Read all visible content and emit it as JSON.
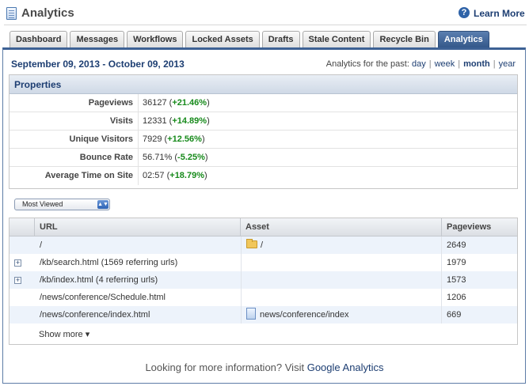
{
  "header": {
    "title": "Analytics",
    "learn_more": "Learn More"
  },
  "tabs": [
    {
      "label": "Dashboard"
    },
    {
      "label": "Messages"
    },
    {
      "label": "Workflows"
    },
    {
      "label": "Locked Assets"
    },
    {
      "label": "Drafts"
    },
    {
      "label": "Stale Content"
    },
    {
      "label": "Recycle Bin"
    },
    {
      "label": "Analytics",
      "active": true
    }
  ],
  "date_range": "September 09, 2013 - October 09, 2013",
  "period": {
    "prefix": "Analytics for the past:",
    "options": [
      "day",
      "week",
      "month",
      "year"
    ],
    "active": "month"
  },
  "properties": {
    "title": "Properties",
    "rows": [
      {
        "label": "Pageviews",
        "value": "36127",
        "delta": "+21.46%"
      },
      {
        "label": "Visits",
        "value": "12331",
        "delta": "+14.89%"
      },
      {
        "label": "Unique Visitors",
        "value": "7929",
        "delta": "+12.56%"
      },
      {
        "label": "Bounce Rate",
        "value": "56.71%",
        "delta": "-5.25%"
      },
      {
        "label": "Average Time on Site",
        "value": "02:57",
        "delta": "+18.79%"
      }
    ]
  },
  "select": {
    "value": "Most Viewed"
  },
  "table": {
    "columns": [
      "URL",
      "Asset",
      "Pageviews"
    ],
    "rows": [
      {
        "url": "/",
        "asset": "/",
        "asset_icon": "folder-icon",
        "pageviews": "2649",
        "expand": false
      },
      {
        "url": "/kb/search.html (1569 referring urls)",
        "asset": "",
        "asset_icon": "",
        "pageviews": "1979",
        "expand": true
      },
      {
        "url": "/kb/index.html (4 referring urls)",
        "asset": "",
        "asset_icon": "",
        "pageviews": "1573",
        "expand": true
      },
      {
        "url": "/news/conference/Schedule.html",
        "asset": "",
        "asset_icon": "",
        "pageviews": "1206",
        "expand": false
      },
      {
        "url": "/news/conference/index.html",
        "asset": "news/conference/index",
        "asset_icon": "page-icon",
        "pageviews": "669",
        "expand": false
      }
    ],
    "show_more": "Show more"
  },
  "footer": {
    "text": "Looking for more information? Visit",
    "link": "Google Analytics"
  },
  "colors": {
    "accent": "#1d3e72",
    "positive": "#178a1b",
    "tab_active": "#3d6194"
  }
}
